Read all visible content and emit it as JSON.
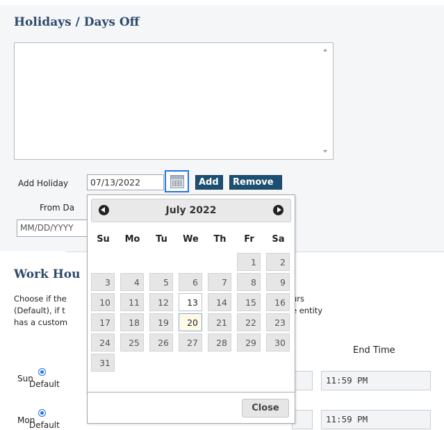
{
  "holidays": {
    "title": "Holidays / Days Off",
    "add_label": "Add Holiday",
    "date_value": "07/13/2022",
    "add_button": "Add",
    "remove_button": "Remove",
    "from_label": "From Da",
    "from_placeholder": "MM/DD/YYYY"
  },
  "work_hours": {
    "title": "Work Hou",
    "desc_lines": [
      "Choose if the",
      "(Default), if t",
      "has a custom"
    ],
    "desc_right_lines": [
      "urs",
      "e entity"
    ],
    "end_time_header": "End Time",
    "rows": [
      {
        "day": "Sun",
        "option": "Default",
        "end_time": "11:59 PM"
      },
      {
        "day": "Mon",
        "option": "Default",
        "end_time": "11:59 PM"
      }
    ]
  },
  "calendar": {
    "title": "July 2022",
    "weekdays": [
      "Su",
      "Mo",
      "Tu",
      "We",
      "Th",
      "Fr",
      "Sa"
    ],
    "days": [
      "1",
      "2",
      "3",
      "4",
      "5",
      "6",
      "7",
      "8",
      "9",
      "10",
      "11",
      "12",
      "13",
      "14",
      "15",
      "16",
      "17",
      "18",
      "19",
      "20",
      "21",
      "22",
      "23",
      "24",
      "25",
      "26",
      "27",
      "28",
      "29",
      "30",
      "31"
    ],
    "first_weekday_index": 5,
    "today": "13",
    "selected": "20",
    "close_label": "Close"
  }
}
